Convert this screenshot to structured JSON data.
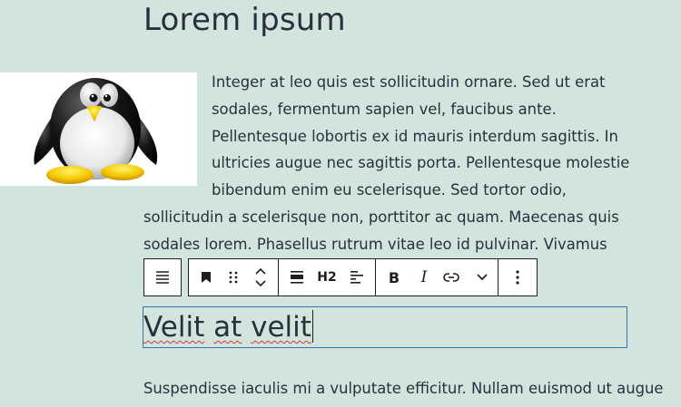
{
  "page": {
    "title": "Lorem ipsum"
  },
  "paragraph1": {
    "text": "Integer at leo quis est sollicitudin ornare. Sed ut erat sodales, fermentum sapien vel, faucibus ante. Pellentesque lobortis ex id mauris interdum sagittis. In ultricies augue nec sagittis porta. Pellentesque molestie bibendum enim eu scelerisque. Sed tortor odio, sollicitudin a scelerisque non, porttitor ac quam. Maecenas quis sodales lorem. Phasellus rutrum vitae leo id pulvinar. Vivamus tempor ex vitae fermentum iaculis."
  },
  "image": {
    "icon": "penguin-image"
  },
  "toolbar": {
    "h2_label": "H2",
    "bold_label": "B",
    "italic_label": "I",
    "icons": [
      "paragraph-icon",
      "bookmark-icon",
      "drag-handle-icon",
      "move-up-down-icon",
      "align-icon",
      "text-align-icon",
      "link-icon",
      "chevron-down-icon",
      "more-options-icon"
    ]
  },
  "heading_block": {
    "word1": "Velit",
    "word2": "at",
    "word3": "velit"
  },
  "paragraph3": {
    "text": "Suspendisse iaculis mi a vulputate efficitur. Nullam euismod ut augue"
  }
}
